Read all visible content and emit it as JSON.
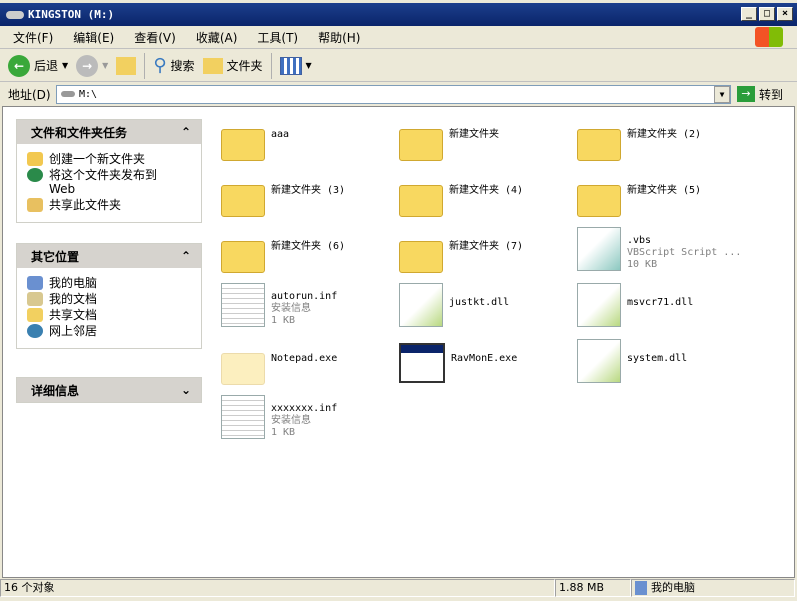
{
  "window": {
    "title": "KINGSTON (M:)",
    "min": "_",
    "max": "□",
    "close": "×"
  },
  "menu": [
    "文件(F)",
    "编辑(E)",
    "查看(V)",
    "收藏(A)",
    "工具(T)",
    "帮助(H)"
  ],
  "toolbar": {
    "back": "后退",
    "search": "搜索",
    "folders": "文件夹"
  },
  "address": {
    "label": "地址(D)",
    "value": "M:\\",
    "go": "转到"
  },
  "panels": [
    {
      "title": "文件和文件夹任务",
      "chevron": "⌃",
      "items": [
        "创建一个新文件夹",
        "将这个文件夹发布到 Web",
        "共享此文件夹"
      ]
    },
    {
      "title": "其它位置",
      "chevron": "⌃",
      "items": [
        "我的电脑",
        "我的文档",
        "共享文档",
        "网上邻居"
      ]
    },
    {
      "title": "详细信息",
      "chevron": "⌄"
    }
  ],
  "files": [
    {
      "name": "aaa",
      "type": "folder"
    },
    {
      "name": "新建文件夹",
      "type": "folder"
    },
    {
      "name": "新建文件夹 (2)",
      "type": "folder"
    },
    {
      "name": "新建文件夹 (3)",
      "type": "folder"
    },
    {
      "name": "新建文件夹 (4)",
      "type": "folder"
    },
    {
      "name": "新建文件夹 (5)",
      "type": "folder"
    },
    {
      "name": "新建文件夹 (6)",
      "type": "folder"
    },
    {
      "name": "新建文件夹 (7)",
      "type": "folder"
    },
    {
      "name": ".vbs",
      "type": "vbs",
      "desc": "VBScript Script ...",
      "size": "10 KB"
    },
    {
      "name": "autorun.inf",
      "type": "inf",
      "desc": "安装信息",
      "size": "1 KB"
    },
    {
      "name": "justkt.dll",
      "type": "dll"
    },
    {
      "name": "msvcr71.dll",
      "type": "dll"
    },
    {
      "name": "Notepad.exe",
      "type": "folder-faded"
    },
    {
      "name": "RavMonE.exe",
      "type": "exe"
    },
    {
      "name": "system.dll",
      "type": "dll"
    },
    {
      "name": "xxxxxxx.inf",
      "type": "inf",
      "desc": "安装信息",
      "size": "1 KB"
    }
  ],
  "status": {
    "objects": "16 个对象",
    "size": "1.88 MB",
    "location": "我的电脑"
  }
}
